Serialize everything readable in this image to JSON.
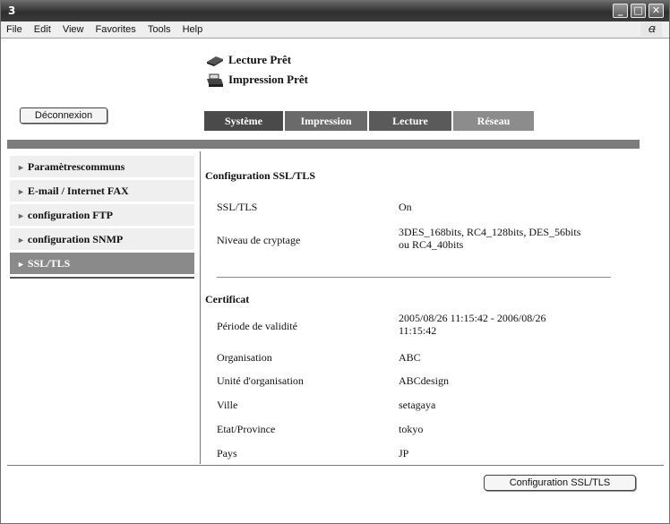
{
  "window": {
    "app_icon": "3"
  },
  "menu": [
    "File",
    "Edit",
    "View",
    "Favorites",
    "Tools",
    "Help"
  ],
  "status": {
    "scan": "Lecture Prêt",
    "print": "Impression Prêt"
  },
  "logout_label": "Déconnexion",
  "tabs": [
    "Système",
    "Impression",
    "Lecture",
    "Réseau"
  ],
  "sidebar": {
    "items": [
      "Paramètrescommuns",
      "E-mail / Internet FAX",
      "configuration FTP",
      "configuration SNMP",
      "SSL/TLS"
    ],
    "active_index": 4
  },
  "ssl_section": {
    "title": "Configuration SSL/TLS",
    "rows": [
      {
        "label": "SSL/TLS",
        "value": "On"
      },
      {
        "label": "Niveau de cryptage",
        "value_line1": "3DES_168bits, RC4_128bits, DES_56bits",
        "value_line2": "ou RC4_40bits"
      }
    ]
  },
  "certificate": {
    "title": "Certificat",
    "validity_label": "Période de validité",
    "validity_line1": "2005/08/26 11:15:42 - 2006/08/26",
    "validity_line2": "11:15:42",
    "rows": [
      {
        "label": "Organisation",
        "value": "ABC"
      },
      {
        "label": "Unité d'organisation",
        "value": "ABCdesign"
      },
      {
        "label": "Ville",
        "value": "setagaya"
      },
      {
        "label": "Etat/Province",
        "value": "tokyo"
      },
      {
        "label": "Pays",
        "value": "JP"
      }
    ]
  },
  "config_button_label": "Configuration SSL/TLS",
  "colors": {
    "tab_system": "#4a4a4a",
    "tab_print": "#6a6a6a",
    "tab_scan": "#5a5a5a",
    "tab_network": "#8c8c8c",
    "sidebar_active": "#8a8a8a"
  }
}
